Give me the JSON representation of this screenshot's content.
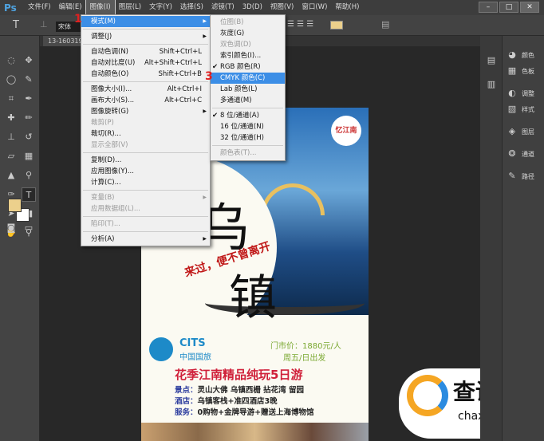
{
  "app": {
    "logo": "Ps",
    "menus": [
      "文件(F)",
      "编辑(E)",
      "图像(I)",
      "图层(L)",
      "文字(Y)",
      "选择(S)",
      "滤镜(T)",
      "3D(D)",
      "视图(V)",
      "窗口(W)",
      "帮助(H)"
    ],
    "window_buttons": [
      "–",
      "□",
      "✕"
    ]
  },
  "options": {
    "tool_glyph": "T",
    "font": "宋体"
  },
  "document": {
    "tab": "13-160319"
  },
  "image_menu": {
    "items": [
      {
        "label": "模式(M)",
        "submenu": true,
        "highlight": true
      },
      {
        "sep": true
      },
      {
        "label": "调整(J)",
        "submenu": true
      },
      {
        "sep": true
      },
      {
        "label": "自动色调(N)",
        "shortcut": "Shift+Ctrl+L"
      },
      {
        "label": "自动对比度(U)",
        "shortcut": "Alt+Shift+Ctrl+L"
      },
      {
        "label": "自动颜色(O)",
        "shortcut": "Shift+Ctrl+B"
      },
      {
        "sep": true
      },
      {
        "label": "图像大小(I)...",
        "shortcut": "Alt+Ctrl+I"
      },
      {
        "label": "画布大小(S)...",
        "shortcut": "Alt+Ctrl+C"
      },
      {
        "label": "图像旋转(G)",
        "submenu": true
      },
      {
        "label": "裁剪(P)",
        "disabled": true
      },
      {
        "label": "裁切(R)..."
      },
      {
        "label": "显示全部(V)",
        "disabled": true
      },
      {
        "sep": true
      },
      {
        "label": "复制(D)..."
      },
      {
        "label": "应用图像(Y)..."
      },
      {
        "label": "计算(C)..."
      },
      {
        "sep": true
      },
      {
        "label": "变量(B)",
        "submenu": true,
        "disabled": true
      },
      {
        "label": "应用数据组(L)...",
        "disabled": true
      },
      {
        "sep": true
      },
      {
        "label": "陷印(T)...",
        "disabled": true
      },
      {
        "sep": true
      },
      {
        "label": "分析(A)",
        "submenu": true
      }
    ]
  },
  "mode_submenu": {
    "items": [
      {
        "label": "位图(B)",
        "disabled": true
      },
      {
        "label": "灰度(G)"
      },
      {
        "label": "双色调(D)",
        "disabled": true
      },
      {
        "label": "索引颜色(I)..."
      },
      {
        "label": "RGB 颜色(R)",
        "checked": true
      },
      {
        "label": "CMYK 颜色(C)",
        "highlight": true
      },
      {
        "label": "Lab 颜色(L)"
      },
      {
        "label": "多通道(M)"
      },
      {
        "sep": true
      },
      {
        "label": "8 位/通道(A)",
        "checked": true
      },
      {
        "label": "16 位/通道(N)"
      },
      {
        "label": "32 位/通道(H)"
      },
      {
        "sep": true
      },
      {
        "label": "颜色表(T)...",
        "disabled": true
      }
    ]
  },
  "annotations": [
    "1",
    "3"
  ],
  "panels": [
    {
      "label": "颜色",
      "icon": "color-icon"
    },
    {
      "label": "色板",
      "icon": "swatches-icon"
    },
    {
      "label": "调整",
      "icon": "adjustments-icon"
    },
    {
      "label": "样式",
      "icon": "styles-icon"
    },
    {
      "label": "图层",
      "icon": "layers-icon"
    },
    {
      "label": "通道",
      "icon": "channels-icon"
    },
    {
      "label": "路径",
      "icon": "paths-icon"
    }
  ],
  "colors": {
    "foreground": "#ecd08c",
    "background": "#ffffff",
    "highlight": "#3c8ee6"
  },
  "poster": {
    "badge": "忆江南",
    "title_chars": [
      "乌",
      "镇"
    ],
    "slogan": "来过，便不曾离开",
    "brand": "CITS",
    "brand_cn": "中国国旅",
    "price": "门市价：1880元/人",
    "depart": "周五/日出发",
    "headline": "花季江南精品纯玩5日游",
    "lines": [
      {
        "k": "景点：",
        "v": "灵山大佛  乌镇西栅  拈花湾  留园"
      },
      {
        "k": "酒店：",
        "v": "乌镇客栈+准四酒店3晚"
      },
      {
        "k": "服务：",
        "v": "0购物+金牌导游+赠送上海博物馆"
      }
    ]
  },
  "watermark": {
    "name": "查询啦",
    "url": "chaxunla.com"
  }
}
